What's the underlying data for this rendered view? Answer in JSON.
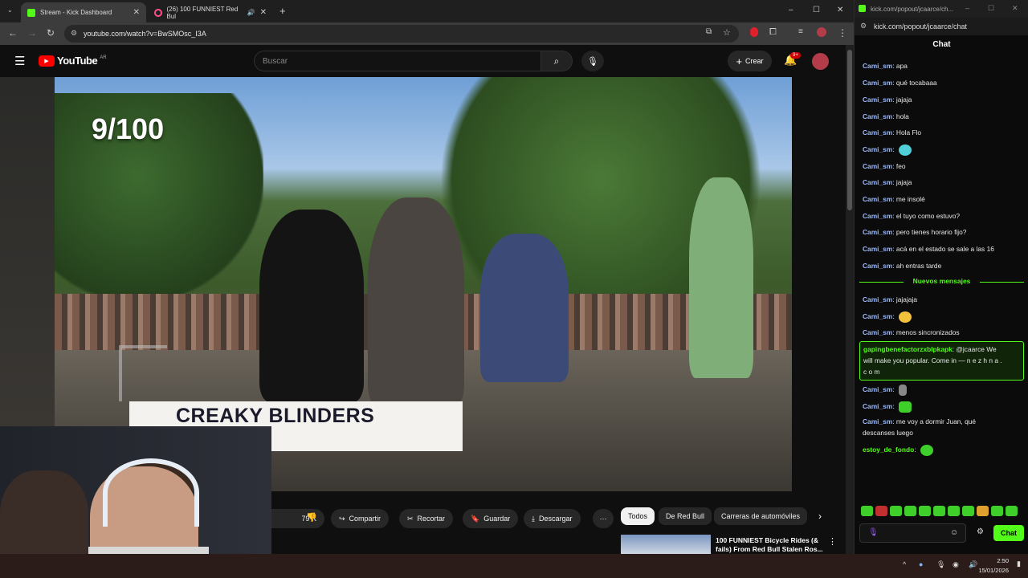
{
  "tabs": [
    {
      "label": "Stream - Kick Dashboard",
      "active": true
    },
    {
      "label": "(26) 100 FUNNIEST Red Bul",
      "active": false
    }
  ],
  "address": {
    "url": "youtube.com/watch?v=BwSMOsc_I3A"
  },
  "youtube": {
    "logo_text": "YouTube",
    "logo_region": "AR",
    "search_placeholder": "Buscar",
    "create_label": "Crear",
    "notifications_badge": "9+"
  },
  "video": {
    "counter": "9/100",
    "caption": "CREAKY BLINDERS"
  },
  "actions": {
    "likes": "79 K",
    "share": "Compartir",
    "clip": "Recortar",
    "save": "Guardar",
    "download": "Descargar"
  },
  "filters": [
    "Todos",
    "De Red Bull",
    "Carreras de automóviles"
  ],
  "related": {
    "title": "100 FUNNIEST Bicycle Rides (&",
    "title_line2": "fails) From Red Bull Stalen Ros..."
  },
  "chat_window": {
    "title": "kick.com/popout/jcaarce/ch...",
    "url": "kick.com/popout/jcaarce/chat",
    "heading": "Chat",
    "new_messages_label": "Nuevos mensajes",
    "messages": [
      {
        "user": "Cami_sm",
        "text": "apa"
      },
      {
        "user": "Cami_sm",
        "text": "qué tocabaaa"
      },
      {
        "user": "Cami_sm",
        "text": "jajaja"
      },
      {
        "user": "Cami_sm",
        "text": "hola"
      },
      {
        "user": "Cami_sm",
        "text": "Hola Flo"
      },
      {
        "user": "Cami_sm",
        "text": ""
      },
      {
        "user": "Cami_sm",
        "text": "feo"
      },
      {
        "user": "Cami_sm",
        "text": "jajaja"
      },
      {
        "user": "Cami_sm",
        "text": "me insolé"
      },
      {
        "user": "Cami_sm",
        "text": "el tuyo como estuvo?"
      },
      {
        "user": "Cami_sm",
        "text": "pero tienes horario fijo?"
      },
      {
        "user": "Cami_sm",
        "text": "acá en el estado se sale a las 16"
      },
      {
        "user": "Cami_sm",
        "text": "ah entras tarde"
      }
    ],
    "new_messages": [
      {
        "user": "Cami_sm",
        "text": "jajajaja"
      },
      {
        "user": "Cami_sm",
        "text": ""
      },
      {
        "user": "Cami_sm",
        "text": "menos sincronizados"
      }
    ],
    "highlight": {
      "user": "gapingbenefactorzxblpkapk",
      "line1": "@jcaarce We",
      "line2": "will make you popular. Come in — n e z h n a .",
      "line3": "c o m"
    },
    "late_messages": [
      {
        "user": "Cami_sm",
        "text": ""
      },
      {
        "user": "Cami_sm",
        "text": ""
      },
      {
        "user": "Cami_sm",
        "text": "me voy a dormir Juan, qué"
      },
      {
        "user": "",
        "text": "descanses luego"
      },
      {
        "user": "estoy_de_fondo",
        "text": ""
      }
    ],
    "send_label": "Chat"
  },
  "taskbar": {
    "time": "2:50",
    "date": "15/01/2026"
  }
}
